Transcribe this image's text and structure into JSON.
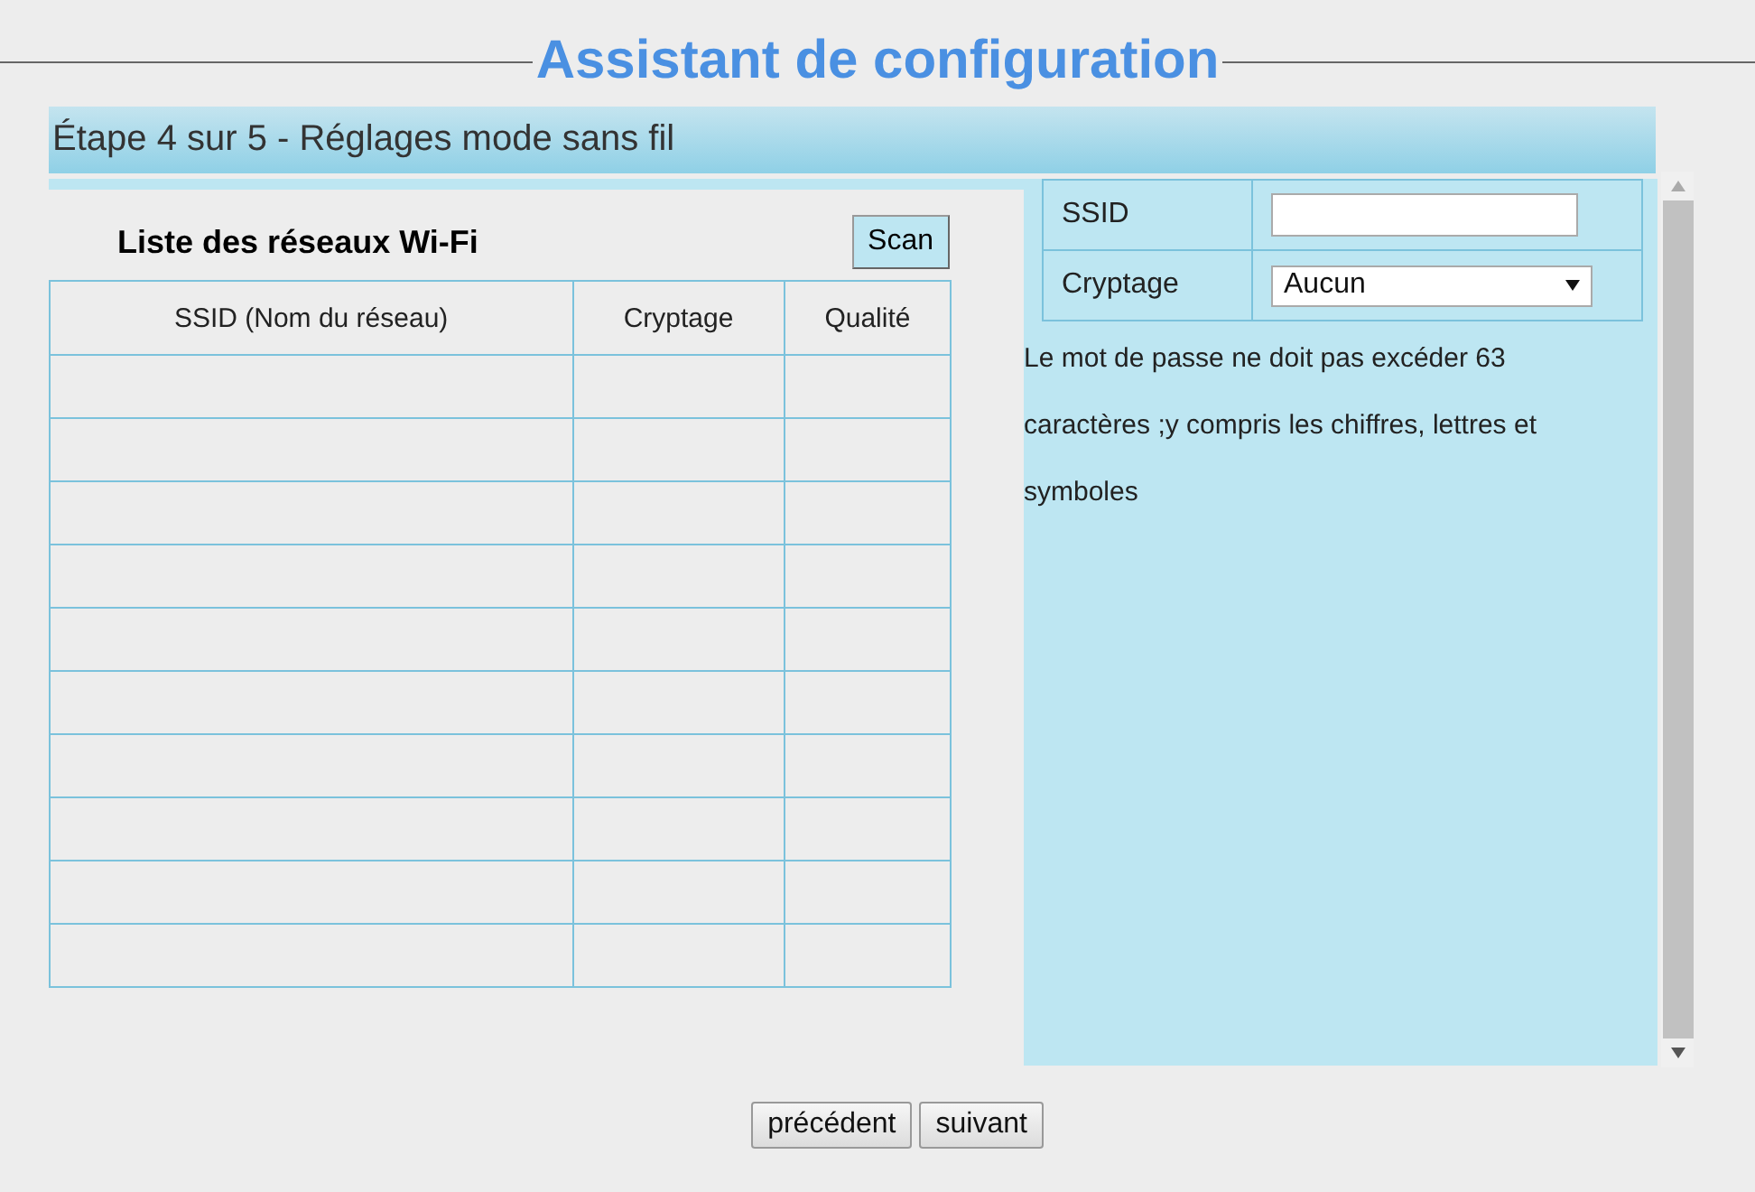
{
  "title": "Assistant de configuration",
  "step": "Étape 4 sur 5 - Réglages mode sans fil",
  "network_list": {
    "title": "Liste des réseaux Wi-Fi",
    "scan_button": "Scan",
    "columns": [
      "SSID (Nom du réseau)",
      "Cryptage",
      "Qualité"
    ]
  },
  "settings": {
    "fields": [
      {
        "kind": "text",
        "label": "SSID"
      },
      {
        "kind": "select",
        "label": "Cryptage",
        "value": "Aucun"
      }
    ],
    "note": "Le mot de passe ne doit pas excéder 63 caractères ;y compris les chiffres, lettres et symboles"
  },
  "buttons": [
    "précédent",
    "suivant"
  ]
}
